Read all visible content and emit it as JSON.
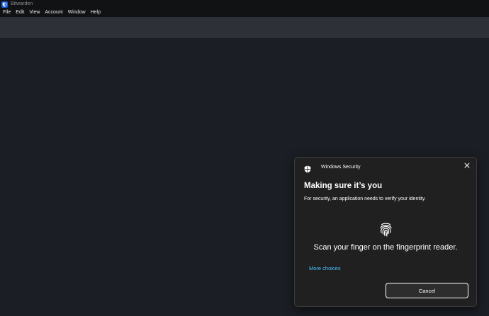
{
  "window": {
    "title": "Bitwarden",
    "app_icon": "bitwarden-shield-icon",
    "accent_color": "#175ddc"
  },
  "menu": {
    "items": [
      {
        "label": "File"
      },
      {
        "label": "Edit"
      },
      {
        "label": "View"
      },
      {
        "label": "Account"
      },
      {
        "label": "Window"
      },
      {
        "label": "Help"
      }
    ]
  },
  "dialog": {
    "header_title": "Windows Security",
    "header_icon": "windows-security-shield-icon",
    "close_icon": "close-icon",
    "title": "Making sure it’s you",
    "subtitle": "For security, an application needs to verify your identity.",
    "main_icon": "fingerprint-icon",
    "prompt": "Scan your finger on the fingerprint reader.",
    "more_choices": "More choices",
    "cancel_label": "Cancel",
    "link_color": "#4cc2ff"
  }
}
